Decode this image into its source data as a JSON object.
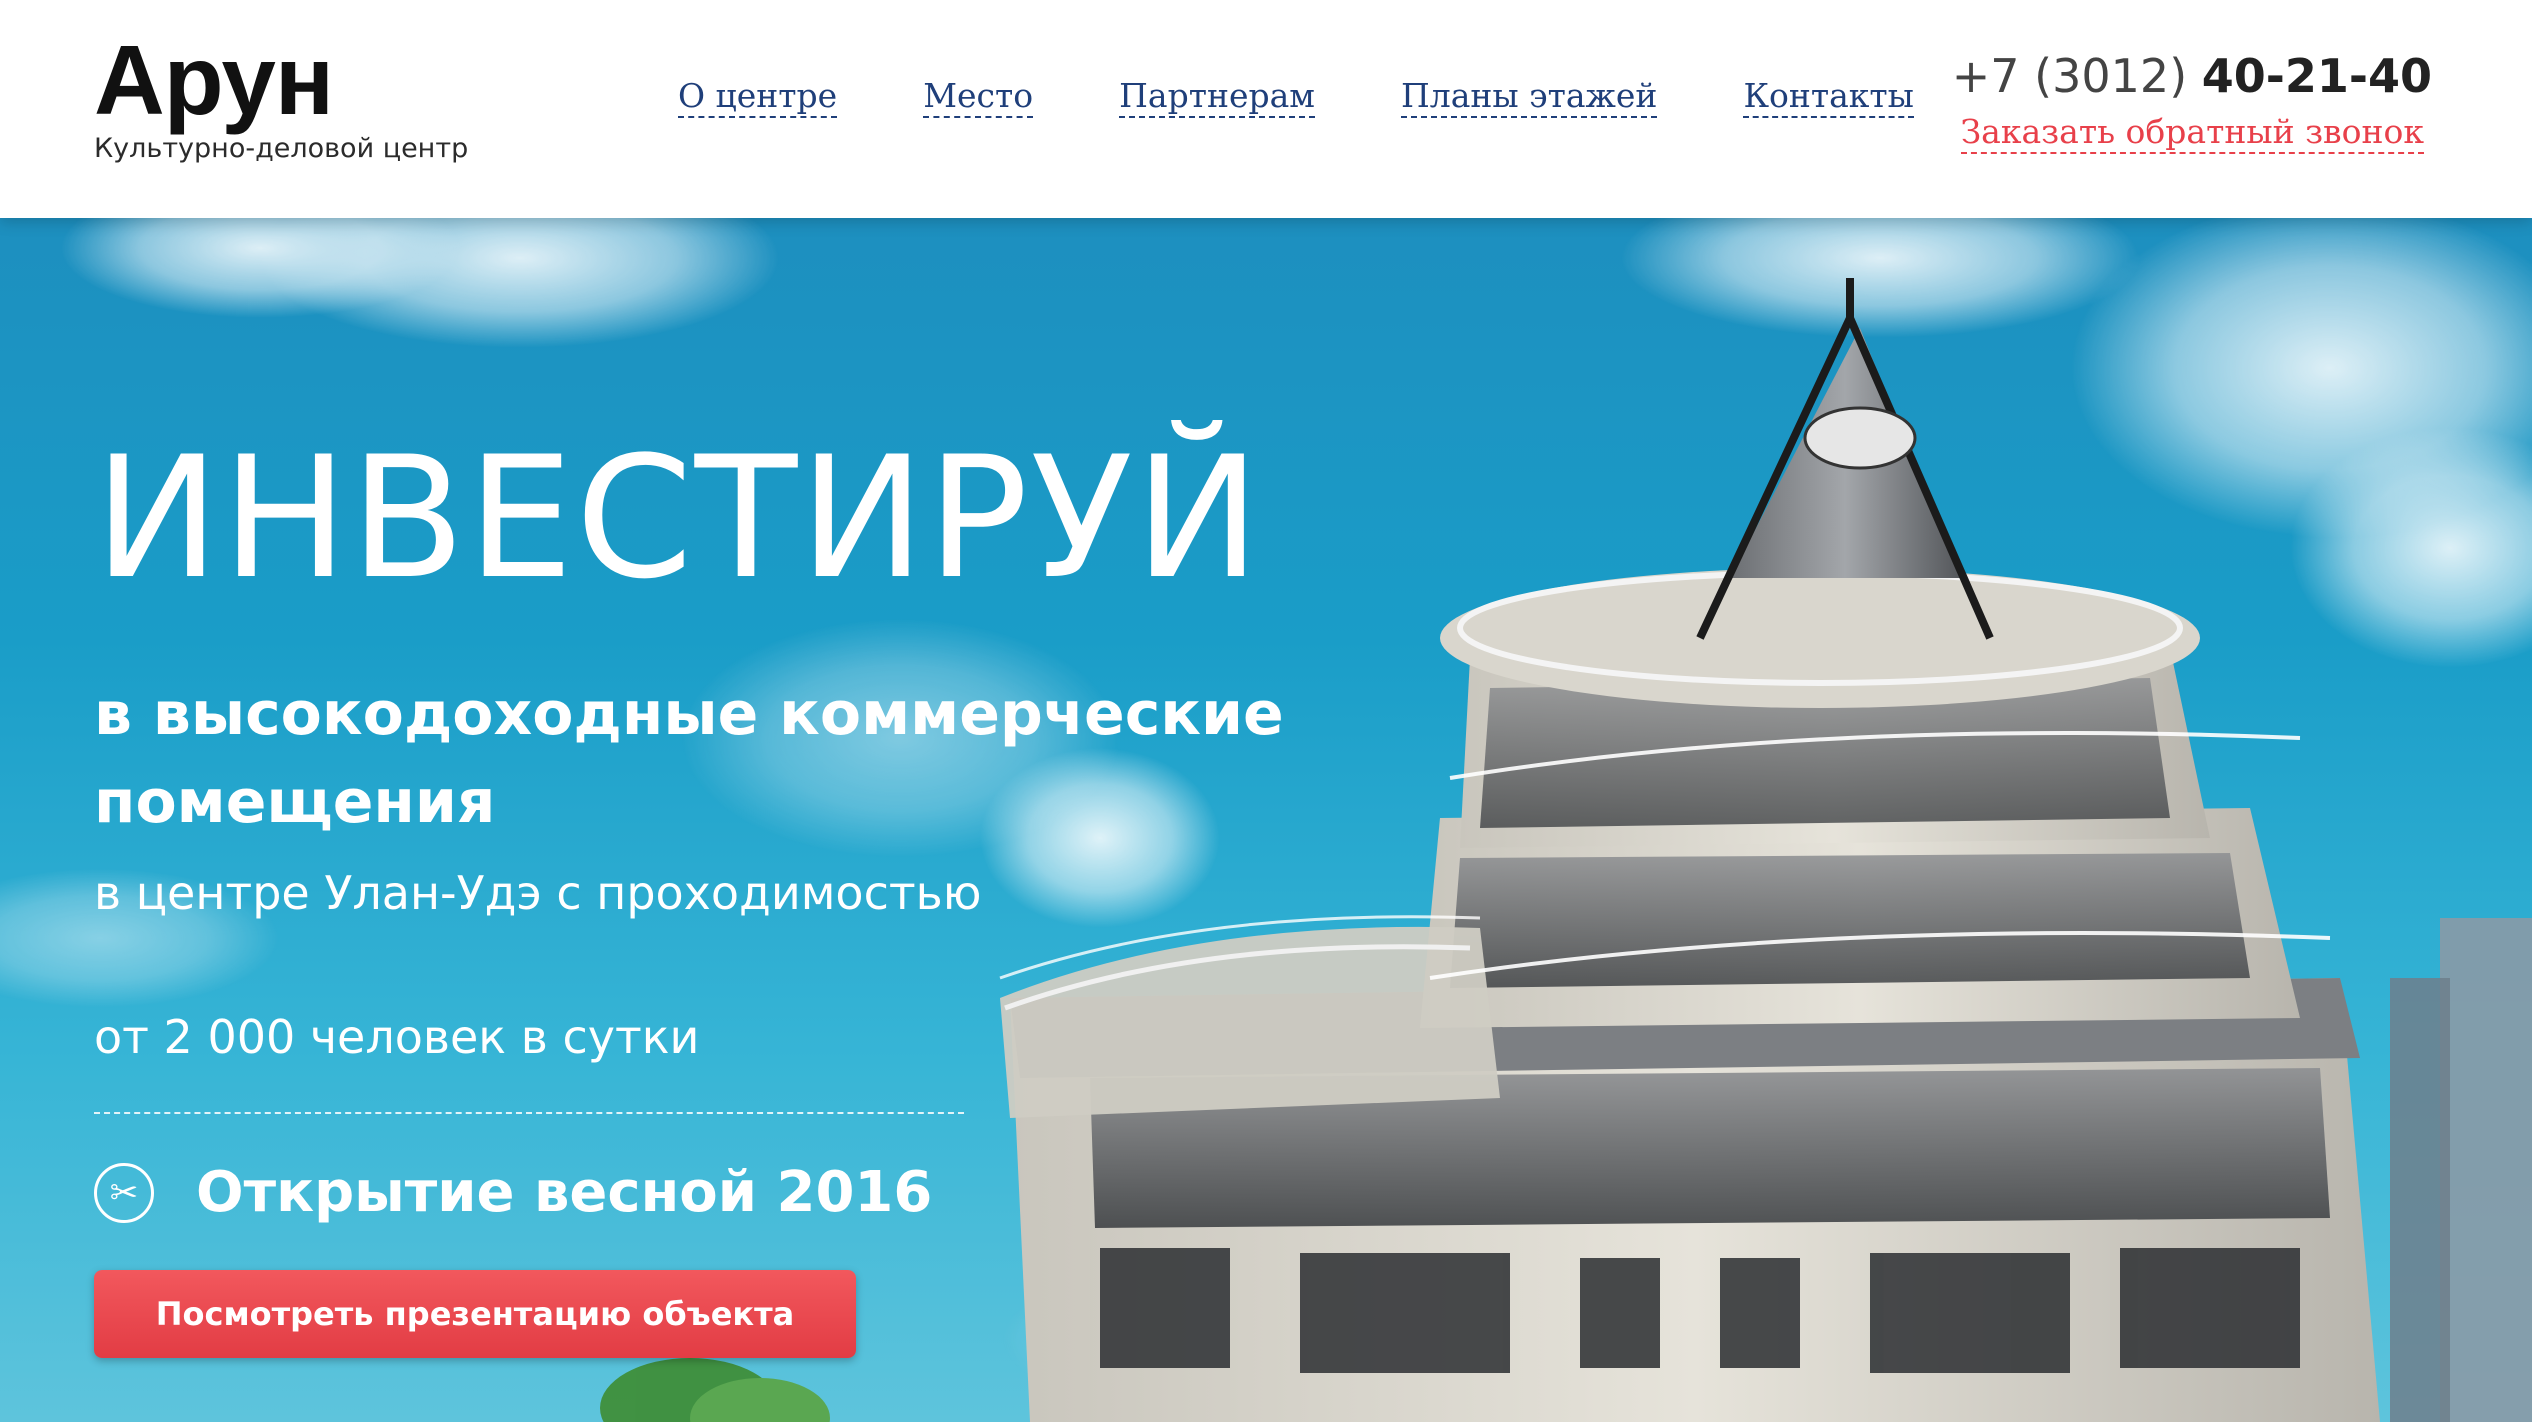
{
  "logo": {
    "title": "Арун",
    "subtitle": "Культурно-деловой центр"
  },
  "nav": {
    "items": [
      {
        "label": "О центре"
      },
      {
        "label": "Место"
      },
      {
        "label": "Партнерам"
      },
      {
        "label": "Планы этажей"
      },
      {
        "label": "Контакты"
      }
    ]
  },
  "contact": {
    "phone_prefix": "+7 (3012) ",
    "phone_main": "40-21-40",
    "callback_label": "Заказать обратный звонок"
  },
  "hero": {
    "headline": "ИНВЕСТИРУЙ",
    "subheading": "в высокодоходные коммерческие помещения",
    "line1": "в центре Улан-Удэ с проходимостью",
    "line2": "от 2 000 человек в сутки",
    "opening": "Открытие весной 2016",
    "cta_label": "Посмотреть презентацию объекта"
  },
  "colors": {
    "nav_link": "#1f3f7a",
    "callback_link": "#e8404a",
    "cta_button": "#e8404a",
    "sky": "#1a9dc8"
  },
  "icons": {
    "opening_icon": "scissors-icon"
  }
}
